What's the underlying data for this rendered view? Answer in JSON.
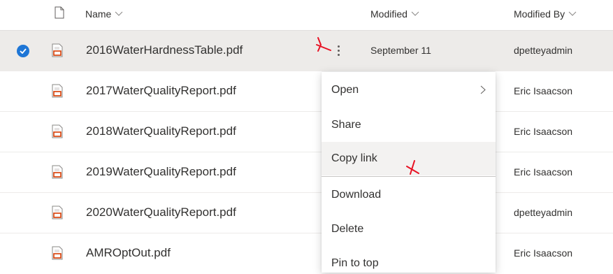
{
  "header": {
    "file_type_icon": "document-icon",
    "columns": [
      {
        "label": "Name"
      },
      {
        "label": "Modified"
      },
      {
        "label": "Modified By"
      }
    ]
  },
  "files": [
    {
      "name": "2016WaterHardnessTable.pdf",
      "modified": "September 11",
      "modified_by": "dpetteyadmin",
      "selected": true,
      "icon": "pdf-icon"
    },
    {
      "name": "2017WaterQualityReport.pdf",
      "modified": "",
      "modified_by": "Eric Isaacson",
      "selected": false,
      "icon": "pdf-icon"
    },
    {
      "name": "2018WaterQualityReport.pdf",
      "modified": "",
      "modified_by": "Eric Isaacson",
      "selected": false,
      "icon": "pdf-icon"
    },
    {
      "name": "2019WaterQualityReport.pdf",
      "modified": "",
      "modified_by": "Eric Isaacson",
      "selected": false,
      "icon": "pdf-icon"
    },
    {
      "name": "2020WaterQualityReport.pdf",
      "modified": "",
      "modified_by": "dpetteyadmin",
      "selected": false,
      "icon": "pdf-icon"
    },
    {
      "name": "AMROptOut.pdf",
      "modified": "",
      "modified_by": "Eric Isaacson",
      "selected": false,
      "icon": "pdf-icon"
    }
  ],
  "context_menu": {
    "items": [
      {
        "label": "Open",
        "has_submenu": true
      },
      {
        "label": "Share"
      },
      {
        "label": "Copy link",
        "highlighted": true
      },
      {
        "label": "Download"
      },
      {
        "label": "Delete"
      },
      {
        "label": "Pin to top"
      }
    ]
  },
  "colors": {
    "accent": "#1e76d6",
    "pdf_red": "#d83b01",
    "annotation_red": "#e81123",
    "selected_row": "#edebe9"
  }
}
